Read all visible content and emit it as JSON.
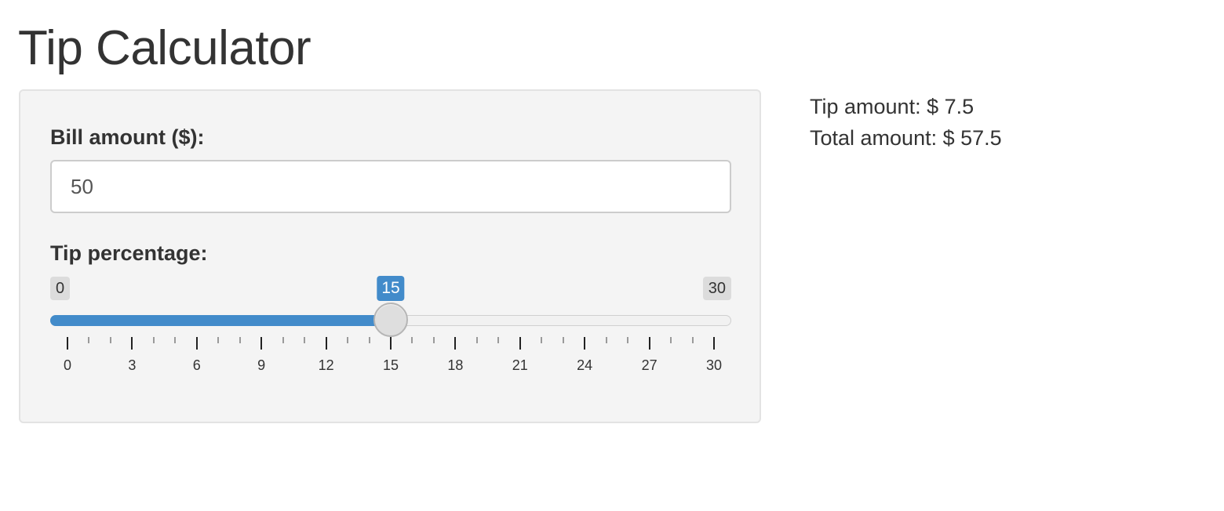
{
  "app": {
    "title": "Tip Calculator"
  },
  "form": {
    "bill": {
      "label": "Bill amount ($):",
      "value": "50"
    },
    "tip": {
      "label": "Tip percentage:",
      "min": 0,
      "max": 30,
      "value": 15,
      "min_label": "0",
      "max_label": "30",
      "value_label": "15",
      "major_ticks": [
        "0",
        "3",
        "6",
        "9",
        "12",
        "15",
        "18",
        "21",
        "24",
        "27",
        "30"
      ],
      "minor_per_major": 2
    }
  },
  "results": {
    "tip_line": "Tip amount: $ 7.5",
    "total_line": "Total amount: $ 57.5"
  },
  "colors": {
    "accent": "#428bca",
    "panel": "#f4f4f4",
    "text": "#333333"
  }
}
